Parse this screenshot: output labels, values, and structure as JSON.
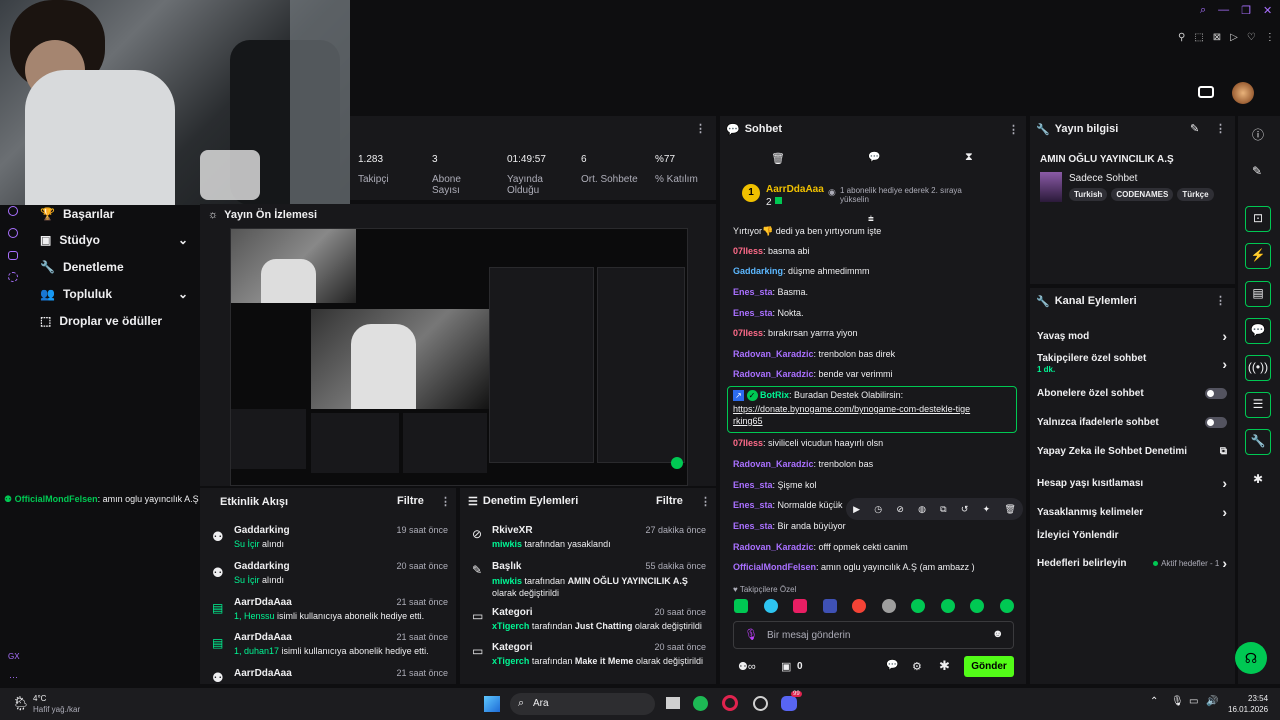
{
  "title_bar": {
    "icons": [
      "search-icon",
      "minimize-icon",
      "restore-icon",
      "close-icon",
      "heart-icon"
    ]
  },
  "top_icons": [
    "pin-icon",
    "crop-icon",
    "save-icon",
    "play-icon",
    "heart-icon"
  ],
  "nav": {
    "items": [
      {
        "label": "Başarılar",
        "icon": "trophy-icon"
      },
      {
        "label": "Stüdyo",
        "icon": "studio-icon",
        "chevron": true
      },
      {
        "label": "Denetleme",
        "icon": "wrench-icon"
      },
      {
        "label": "Topluluk",
        "icon": "people-icon",
        "chevron": true
      },
      {
        "label": "Droplar ve ödüller",
        "icon": "drops-icon"
      }
    ]
  },
  "stats": [
    {
      "value": "1.283",
      "label": "Takipçi"
    },
    {
      "value": "3",
      "label": "Abone Sayısı"
    },
    {
      "value": "01:49:57",
      "label": "Yayında Olduğu"
    },
    {
      "value": "6",
      "label": "Ort. Sohbete"
    },
    {
      "value": "%77",
      "label": "% Katılım"
    }
  ],
  "preview": {
    "title": "Yayın Ön İzlemesi"
  },
  "overlay_chat": {
    "user": "OfficialMondFelsen",
    "text": ": amın oglu yayıncılık A.Ş (am ambazz)"
  },
  "activity": {
    "title": "Etkinlik Akışı",
    "filter": "Filtre",
    "items": [
      {
        "name": "Gaddarking",
        "time": "19 saat önce",
        "detail": "Su İçir",
        "detail2": " alındı"
      },
      {
        "name": "Gaddarking",
        "time": "20 saat önce",
        "detail": "Su İçir",
        "detail2": " alındı"
      },
      {
        "name": "AarrDdaAaa",
        "time": "21 saat önce",
        "detail": "1, Henssu",
        "detail2": " isimli kullanıcıya abonelik hediye etti."
      },
      {
        "name": "AarrDdaAaa",
        "time": "21 saat önce",
        "detail": "1, duhan17",
        "detail2": " isimli kullanıcıya abonelik hediye etti."
      },
      {
        "name": "AarrDdaAaa",
        "time": "21 saat önce",
        "detail": "",
        "detail2": ""
      }
    ]
  },
  "mod_actions": {
    "title": "Denetim Eylemleri",
    "filter": "Filtre",
    "items": [
      {
        "name": "RkiveXR",
        "time": "27 dakika önce",
        "who": "miwkis",
        "rest": " tarafından yasaklandı",
        "bold": "",
        "rest2": ""
      },
      {
        "name": "Başlık",
        "time": "55 dakika önce",
        "who": "miwkis",
        "rest": " tarafından ",
        "bold": "AMIN OĞLU YAYINCILIK A.Ş",
        "rest2": " olarak değiştirildi"
      },
      {
        "name": "Kategori",
        "time": "20 saat önce",
        "who": "xTigerch",
        "rest": " tarafından ",
        "bold": "Just Chatting",
        "rest2": " olarak değiştirildi"
      },
      {
        "name": "Kategori",
        "time": "20 saat önce",
        "who": "xTigerch",
        "rest": " tarafından ",
        "bold": "Make it Meme",
        "rest2": " olarak değiştirildi"
      }
    ]
  },
  "chat": {
    "title": "Sohbet",
    "pinned": {
      "user": "AarrDdaAaa",
      "count": "2",
      "text": "1 abonelik hediye ederek 2. sıraya yükselin"
    },
    "messages": [
      {
        "user": "",
        "color": "#efeff1",
        "text": "Yırtıyor👎 dedi ya ben yırtıyorum işte"
      },
      {
        "user": "07Iless",
        "color": "#ff6b8a",
        "text": ": basma abi"
      },
      {
        "user": "Gaddarking",
        "color": "#5cb8ff",
        "text": ": düşme ahmedimmm"
      },
      {
        "user": "Enes_sta",
        "color": "#a970ff",
        "text": ": Basma."
      },
      {
        "user": "Enes_sta",
        "color": "#a970ff",
        "text": ": Nokta."
      },
      {
        "user": "07Iless",
        "color": "#ff6b8a",
        "text": ": bırakırsan yarrra yiyon"
      },
      {
        "user": "Radovan_Karadzic",
        "color": "#a970ff",
        "text": ": trenbolon bas direk"
      },
      {
        "user": "Radovan_Karadzic",
        "color": "#a970ff",
        "text": ": bende var verimmi"
      }
    ],
    "botrix": {
      "user": "BotRix",
      "text": ": Buradan Destek Olabilirsin:",
      "link": "https://donate.bynogame.com/bynogame-com-destekle-tigerking65"
    },
    "messages2": [
      {
        "user": "07Iless",
        "color": "#ff6b8a",
        "text": ": siviliceli vicudun haayırlı olsn"
      },
      {
        "user": "Radovan_Karadzic",
        "color": "#a970ff",
        "text": ": trenbolon bas"
      },
      {
        "user": "Enes_sta",
        "color": "#a970ff",
        "text": ": Şişme kol"
      },
      {
        "user": "Enes_sta",
        "color": "#a970ff",
        "text": ": Normalde küçük"
      },
      {
        "user": "Enes_sta",
        "color": "#a970ff",
        "text": ": Bir anda büyüyor"
      },
      {
        "user": "Radovan_Karadzic",
        "color": "#a970ff",
        "text": ": offf opmek cekti canim"
      },
      {
        "user": "OfficialMondFelsen",
        "color": "#a970ff",
        "text": ": amın oglu yayıncılık A.Ş (am ambazz )"
      }
    ],
    "followers_only": "Takipçilere Özel",
    "input_placeholder": "Bir mesaj gönderin",
    "points": "0",
    "send": "Gönder"
  },
  "stream_info": {
    "title": "Yayın bilgisi",
    "name": "AMIN OĞLU YAYINCILIK A.Ş",
    "category": "Sadece Sohbet",
    "tags": [
      "Turkish",
      "CODENAMES",
      "Türkçe"
    ]
  },
  "channel_actions": {
    "title": "Kanal Eylemleri",
    "items": [
      {
        "label": "Yavaş mod",
        "type": "chevron",
        "sub": ""
      },
      {
        "label": "Takipçilere özel sohbet",
        "type": "chevron",
        "sub": "1 dk."
      },
      {
        "label": "Abonelere özel sohbet",
        "type": "toggle",
        "sub": ""
      },
      {
        "label": "Yalnızca ifadelerle sohbet",
        "type": "toggle",
        "sub": ""
      },
      {
        "label": "Yapay Zeka ile Sohbet Denetimi",
        "type": "external",
        "sub": ""
      },
      {
        "label": "Hesap yaşı kısıtlaması",
        "type": "chevron",
        "sub": ""
      },
      {
        "label": "Yasaklanmış kelimeler",
        "type": "chevron",
        "sub": ""
      },
      {
        "label": "İzleyici Yönlendir",
        "type": "none",
        "sub": ""
      },
      {
        "label": "Hedefleri belirleyin",
        "type": "goal",
        "sub": "Aktif hedefler - 1"
      }
    ]
  },
  "left_bottom": "GX",
  "taskbar": {
    "weather_temp": "4°C",
    "weather_desc": "Hafif yağ./kar",
    "search": "Ara",
    "time": "23:54",
    "date": "16.01.2026",
    "badge": "99"
  }
}
